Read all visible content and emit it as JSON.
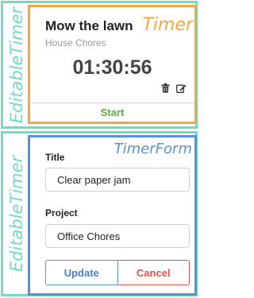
{
  "annotations": {
    "outer_top_label": "EditableTimer",
    "outer_bottom_label": "EditableTimer",
    "timer_component_label": "Timer",
    "form_component_label": "TimerForm"
  },
  "timer": {
    "title": "Mow the lawn",
    "project": "House Chores",
    "elapsed": "01:30:56",
    "icons": [
      "trash-icon",
      "edit-icon"
    ],
    "start_label": "Start"
  },
  "form": {
    "title_label": "Title",
    "title_value": "Clear paper jam",
    "project_label": "Project",
    "project_value": "Office Chores",
    "update_label": "Update",
    "cancel_label": "Cancel"
  },
  "colors": {
    "editable_timer": "#6fdcc4",
    "timer": "#f5a83a",
    "timer_form": "#5b8fd6",
    "start": "#5fa83f",
    "cancel": "#d9534f"
  }
}
